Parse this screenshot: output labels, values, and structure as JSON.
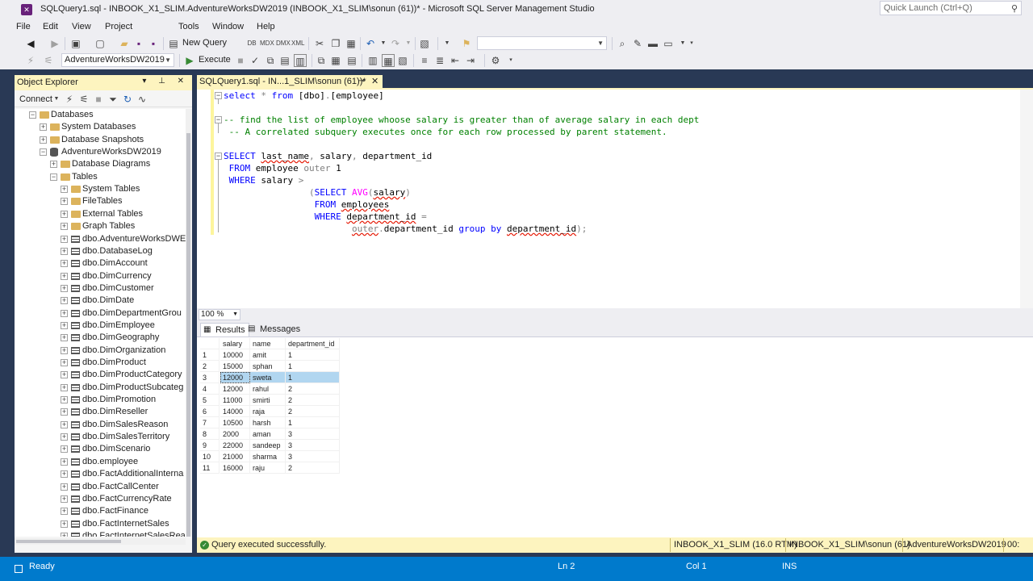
{
  "window": {
    "title": "SQLQuery1.sql - INBOOK_X1_SLIM.AdventureWorksDW2019 (INBOOK_X1_SLIM\\sonun (61))* - Microsoft SQL Server Management Studio",
    "quick_launch_placeholder": "Quick Launch (Ctrl+Q)"
  },
  "menu": [
    "File",
    "Edit",
    "View",
    "Project",
    "Tools",
    "Window",
    "Help"
  ],
  "toolbar": {
    "new_query_label": "New Query",
    "database_selected": "AdventureWorksDW2019",
    "execute_label": "Execute",
    "solution_combo_value": ""
  },
  "object_explorer": {
    "title": "Object Explorer",
    "connect_label": "Connect",
    "tree": [
      {
        "label": "Databases",
        "indent": 0,
        "expander": "−",
        "icon": "folder"
      },
      {
        "label": "System Databases",
        "indent": 1,
        "expander": "+",
        "icon": "folder"
      },
      {
        "label": "Database Snapshots",
        "indent": 1,
        "expander": "+",
        "icon": "folder"
      },
      {
        "label": "AdventureWorksDW2019",
        "indent": 1,
        "expander": "−",
        "icon": "database"
      },
      {
        "label": "Database Diagrams",
        "indent": 2,
        "expander": "+",
        "icon": "folder"
      },
      {
        "label": "Tables",
        "indent": 2,
        "expander": "−",
        "icon": "folder"
      },
      {
        "label": "System Tables",
        "indent": 3,
        "expander": "+",
        "icon": "folder"
      },
      {
        "label": "FileTables",
        "indent": 3,
        "expander": "+",
        "icon": "folder"
      },
      {
        "label": "External Tables",
        "indent": 3,
        "expander": "+",
        "icon": "folder"
      },
      {
        "label": "Graph Tables",
        "indent": 3,
        "expander": "+",
        "icon": "folder"
      },
      {
        "label": "dbo.AdventureWorksDWE",
        "indent": 3,
        "expander": "+",
        "icon": "table"
      },
      {
        "label": "dbo.DatabaseLog",
        "indent": 3,
        "expander": "+",
        "icon": "table"
      },
      {
        "label": "dbo.DimAccount",
        "indent": 3,
        "expander": "+",
        "icon": "table"
      },
      {
        "label": "dbo.DimCurrency",
        "indent": 3,
        "expander": "+",
        "icon": "table"
      },
      {
        "label": "dbo.DimCustomer",
        "indent": 3,
        "expander": "+",
        "icon": "table"
      },
      {
        "label": "dbo.DimDate",
        "indent": 3,
        "expander": "+",
        "icon": "table"
      },
      {
        "label": "dbo.DimDepartmentGrou",
        "indent": 3,
        "expander": "+",
        "icon": "table"
      },
      {
        "label": "dbo.DimEmployee",
        "indent": 3,
        "expander": "+",
        "icon": "table"
      },
      {
        "label": "dbo.DimGeography",
        "indent": 3,
        "expander": "+",
        "icon": "table"
      },
      {
        "label": "dbo.DimOrganization",
        "indent": 3,
        "expander": "+",
        "icon": "table"
      },
      {
        "label": "dbo.DimProduct",
        "indent": 3,
        "expander": "+",
        "icon": "table"
      },
      {
        "label": "dbo.DimProductCategory",
        "indent": 3,
        "expander": "+",
        "icon": "table"
      },
      {
        "label": "dbo.DimProductSubcateg",
        "indent": 3,
        "expander": "+",
        "icon": "table"
      },
      {
        "label": "dbo.DimPromotion",
        "indent": 3,
        "expander": "+",
        "icon": "table"
      },
      {
        "label": "dbo.DimReseller",
        "indent": 3,
        "expander": "+",
        "icon": "table"
      },
      {
        "label": "dbo.DimSalesReason",
        "indent": 3,
        "expander": "+",
        "icon": "table"
      },
      {
        "label": "dbo.DimSalesTerritory",
        "indent": 3,
        "expander": "+",
        "icon": "table"
      },
      {
        "label": "dbo.DimScenario",
        "indent": 3,
        "expander": "+",
        "icon": "table"
      },
      {
        "label": "dbo.employee",
        "indent": 3,
        "expander": "+",
        "icon": "table"
      },
      {
        "label": "dbo.FactAdditionalInterna",
        "indent": 3,
        "expander": "+",
        "icon": "table"
      },
      {
        "label": "dbo.FactCallCenter",
        "indent": 3,
        "expander": "+",
        "icon": "table"
      },
      {
        "label": "dbo.FactCurrencyRate",
        "indent": 3,
        "expander": "+",
        "icon": "table"
      },
      {
        "label": "dbo.FactFinance",
        "indent": 3,
        "expander": "+",
        "icon": "table"
      },
      {
        "label": "dbo.FactInternetSales",
        "indent": 3,
        "expander": "+",
        "icon": "table"
      },
      {
        "label": "dbo.FactInternetSalesReas",
        "indent": 3,
        "expander": "+",
        "icon": "table"
      }
    ]
  },
  "document_tab": {
    "label": "SQLQuery1.sql - IN...1_SLIM\\sonun (61))*"
  },
  "editor": {
    "zoom": "100 %"
  },
  "results": {
    "tab_results": "Results",
    "tab_messages": "Messages",
    "columns": [
      "salary",
      "name",
      "department_id"
    ],
    "rows": [
      {
        "n": "1",
        "salary": "10000",
        "name": "amit",
        "dept": "1"
      },
      {
        "n": "2",
        "salary": "15000",
        "name": "sphan",
        "dept": "1"
      },
      {
        "n": "3",
        "salary": "12000",
        "name": "sweta",
        "dept": "1"
      },
      {
        "n": "4",
        "salary": "12000",
        "name": "rahul",
        "dept": "2"
      },
      {
        "n": "5",
        "salary": "11000",
        "name": "smirti",
        "dept": "2"
      },
      {
        "n": "6",
        "salary": "14000",
        "name": "raja",
        "dept": "2"
      },
      {
        "n": "7",
        "salary": "10500",
        "name": "harsh",
        "dept": "1"
      },
      {
        "n": "8",
        "salary": "2000",
        "name": "aman",
        "dept": "3"
      },
      {
        "n": "9",
        "salary": "22000",
        "name": "sandeep",
        "dept": "3"
      },
      {
        "n": "10",
        "salary": "21000",
        "name": "sharma",
        "dept": "3"
      },
      {
        "n": "11",
        "salary": "16000",
        "name": "raju",
        "dept": "2"
      }
    ],
    "selected_row": 2
  },
  "query_status": {
    "message": "Query executed successfully.",
    "server": "INBOOK_X1_SLIM (16.0 RTM)",
    "user": "INBOOK_X1_SLIM\\sonun (61)",
    "database": "AdventureWorksDW2019",
    "time": "00:"
  },
  "statusbar": {
    "ready": "Ready",
    "line": "Ln 2",
    "col": "Col 1",
    "mode": "INS"
  },
  "colors": {
    "accent": "#007acc",
    "tab_active": "#fdf4bf",
    "dock_background": "#293955",
    "success": "#388a34"
  }
}
